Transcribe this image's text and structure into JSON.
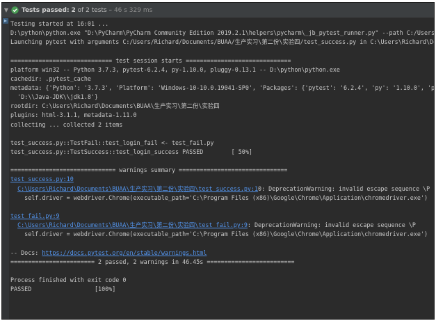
{
  "status": {
    "passed_label": "Tests passed:",
    "passed_count": "2",
    "of_text": "of 2 tests –",
    "duration": "46 s 329 ms"
  },
  "console": {
    "lines": [
      {
        "type": "text",
        "text": "Testing started at 16:01 ..."
      },
      {
        "type": "text",
        "text": "D:\\python\\python.exe \"D:\\PyCharm\\PyCharm Community Edition 2019.2.1\\helpers\\pycharm\\_jb_pytest_runner.py\" --path C:/Users/Richard/"
      },
      {
        "type": "text",
        "text": "Launching pytest with arguments C:/Users/Richard/Documents/BUAA/生产实习\\第二份\\实验四/test_success.py in C:\\Users\\Richard\\Document"
      },
      {
        "type": "blank",
        "text": ""
      },
      {
        "type": "text",
        "text": "============================= test session starts =============================="
      },
      {
        "type": "text",
        "text": "platform win32 -- Python 3.7.3, pytest-6.2.4, py-1.10.0, pluggy-0.13.1 -- D:\\python\\python.exe"
      },
      {
        "type": "text",
        "text": "cachedir: .pytest_cache"
      },
      {
        "type": "text",
        "text": "metadata: {'Python': '3.7.3', 'Platform': 'Windows-10-10.0.19041-SP0', 'Packages': {'pytest': '6.2.4', 'py': '1.10.0', 'pluggy': '"
      },
      {
        "type": "text",
        "text": "  'D:\\\\Java-JDK\\\\jdk1.8'}"
      },
      {
        "type": "text",
        "text": "rootdir: C:\\Users\\Richard\\Documents\\BUAA\\生产实习\\第二份\\实验四"
      },
      {
        "type": "text",
        "text": "plugins: html-3.1.1, metadata-1.11.0"
      },
      {
        "type": "text",
        "text": "collecting ... collected 2 items"
      },
      {
        "type": "blank",
        "text": ""
      },
      {
        "type": "text",
        "text": "test_success.py::TestFail::test_login_fail <- test_fail.py"
      },
      {
        "type": "text",
        "text": "test_success.py::TestSuccess::test_login_success PASSED        [ 50%]"
      },
      {
        "type": "blank",
        "text": ""
      },
      {
        "type": "text",
        "text": "============================== warnings summary ==============================="
      },
      {
        "type": "link",
        "text": "test_success.py:10"
      },
      {
        "type": "mixed",
        "indent": "  ",
        "link": "C:\\Users\\Richard\\Documents\\BUAA\\生产实习\\第二份\\实验四\\test_success.py:1",
        "rest": "0: DeprecationWarning: invalid escape sequence \\P"
      },
      {
        "type": "text",
        "text": "    self.driver = webdriver.Chrome(executable_path='C:\\Program Files (x86)\\Google\\Chrome\\Application\\chromedriver.exe')"
      },
      {
        "type": "blank",
        "text": ""
      },
      {
        "type": "link",
        "text": "test_fail.py:9"
      },
      {
        "type": "mixed",
        "indent": "  ",
        "link": "C:\\Users\\Richard\\Documents\\BUAA\\生产实习\\第二份\\实验四\\test_fail.py:9",
        "rest": ": DeprecationWarning: invalid escape sequence \\P"
      },
      {
        "type": "text",
        "text": "    self.driver = webdriver.Chrome(executable_path='C:\\Program Files (x86)\\Google\\Chrome\\Application\\chromedriver.exe')"
      },
      {
        "type": "blank",
        "text": ""
      },
      {
        "type": "mixed",
        "indent": "",
        "prefix": "-- Docs: ",
        "link": "https://docs.pytest.org/en/stable/warnings.html",
        "rest": ""
      },
      {
        "type": "text",
        "text": "======================== 2 passed, 2 warnings in 46.45s ========================="
      },
      {
        "type": "blank",
        "text": ""
      },
      {
        "type": "text",
        "text": "Process finished with exit code 0"
      },
      {
        "type": "text",
        "text": "PASSED                  [100%]"
      }
    ]
  },
  "colors": {
    "background": "#2b2b2b",
    "statusbar": "#3c3f41",
    "text": "#c8c8c8",
    "link": "#5394ec",
    "success": "#499c54"
  },
  "icons": {
    "status": "check-icon",
    "collapse": "chevron-down-icon",
    "gutter": "warning-marker-icon"
  }
}
